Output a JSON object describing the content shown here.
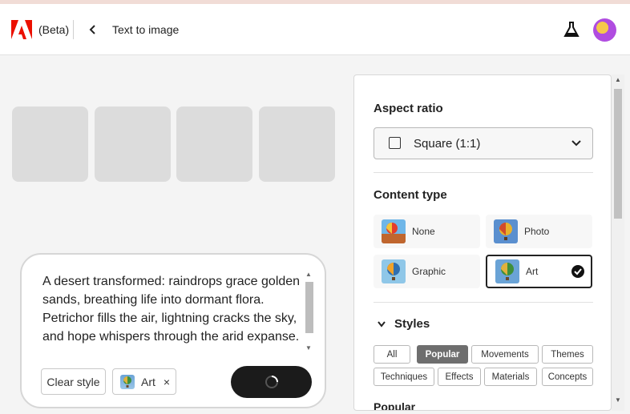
{
  "header": {
    "beta_label": "(Beta)",
    "page_title": "Text to image"
  },
  "prompt": {
    "text": "A desert transformed: raindrops grace golden sands, breathing life into dormant flora. Petrichor fills the air, lightning cracks the sky, and hope whispers through the arid expanse.",
    "clear_style_label": "Clear style",
    "style_chip_label": "Art",
    "style_chip_close": "×"
  },
  "panel": {
    "aspect_ratio": {
      "title": "Aspect ratio",
      "selected": "Square (1:1)"
    },
    "content_type": {
      "title": "Content type",
      "options": [
        {
          "label": "None",
          "selected": false
        },
        {
          "label": "Photo",
          "selected": false
        },
        {
          "label": "Graphic",
          "selected": false
        },
        {
          "label": "Art",
          "selected": true
        }
      ]
    },
    "styles": {
      "title": "Styles",
      "tabs": [
        "All",
        "Popular",
        "Movements",
        "Themes",
        "Techniques",
        "Effects",
        "Materials",
        "Concepts"
      ],
      "active_tab": "Popular",
      "subheading": "Popular"
    }
  },
  "icons": {
    "logo": "adobe-logo-icon",
    "back": "chevron-left-icon",
    "labs": "flask-icon",
    "dropdown": "chevron-down-icon",
    "collapse": "chevron-down-icon",
    "check": "checkmark-icon",
    "loading": "spinner-icon"
  },
  "colors": {
    "brand": "#eb1000",
    "generate_button": "#1b1b1b",
    "active_tab": "#6e6e6e"
  }
}
